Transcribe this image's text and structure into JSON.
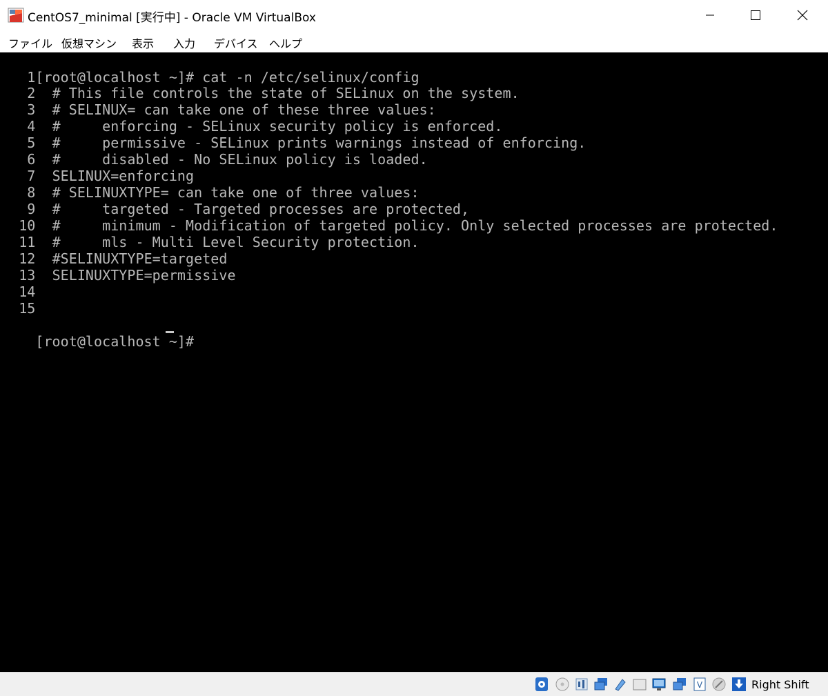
{
  "window": {
    "title": "CentOS7_minimal [実行中] - Oracle VM VirtualBox",
    "icon": "virtualbox-icon"
  },
  "menu": {
    "items": [
      "ファイル",
      "仮想マシン",
      "表示",
      "入力",
      "デバイス",
      "ヘルプ"
    ]
  },
  "terminal": {
    "prompt_command": "[root@localhost ~]# cat -n /etc/selinux/config",
    "lines": [
      {
        "n": "1",
        "text": ""
      },
      {
        "n": "2",
        "text": "# This file controls the state of SELinux on the system."
      },
      {
        "n": "3",
        "text": "# SELINUX= can take one of these three values:"
      },
      {
        "n": "4",
        "text": "#     enforcing - SELinux security policy is enforced."
      },
      {
        "n": "5",
        "text": "#     permissive - SELinux prints warnings instead of enforcing."
      },
      {
        "n": "6",
        "text": "#     disabled - No SELinux policy is loaded."
      },
      {
        "n": "7",
        "text": "SELINUX=enforcing"
      },
      {
        "n": "8",
        "text": "# SELINUXTYPE= can take one of three values:"
      },
      {
        "n": "9",
        "text": "#     targeted - Targeted processes are protected,"
      },
      {
        "n": "10",
        "text": "#     minimum - Modification of targeted policy. Only selected processes are protected."
      },
      {
        "n": "11",
        "text": "#     mls - Multi Level Security protection."
      },
      {
        "n": "12",
        "text": "#SELINUXTYPE=targeted"
      },
      {
        "n": "13",
        "text": "SELINUXTYPE=permissive"
      },
      {
        "n": "14",
        "text": ""
      },
      {
        "n": "15",
        "text": ""
      }
    ],
    "final_prompt": "[root@localhost ~]# "
  },
  "statusbar": {
    "host_key": "Right Shift",
    "icons": [
      "storage-icon",
      "optical-drive-icon",
      "audio-icon",
      "network-icon",
      "usb-icon",
      "shared-folders-icon",
      "display-icon",
      "recording-icon",
      "virtualization-icon",
      "mouse-integration-icon",
      "keyboard-capture-icon"
    ]
  }
}
